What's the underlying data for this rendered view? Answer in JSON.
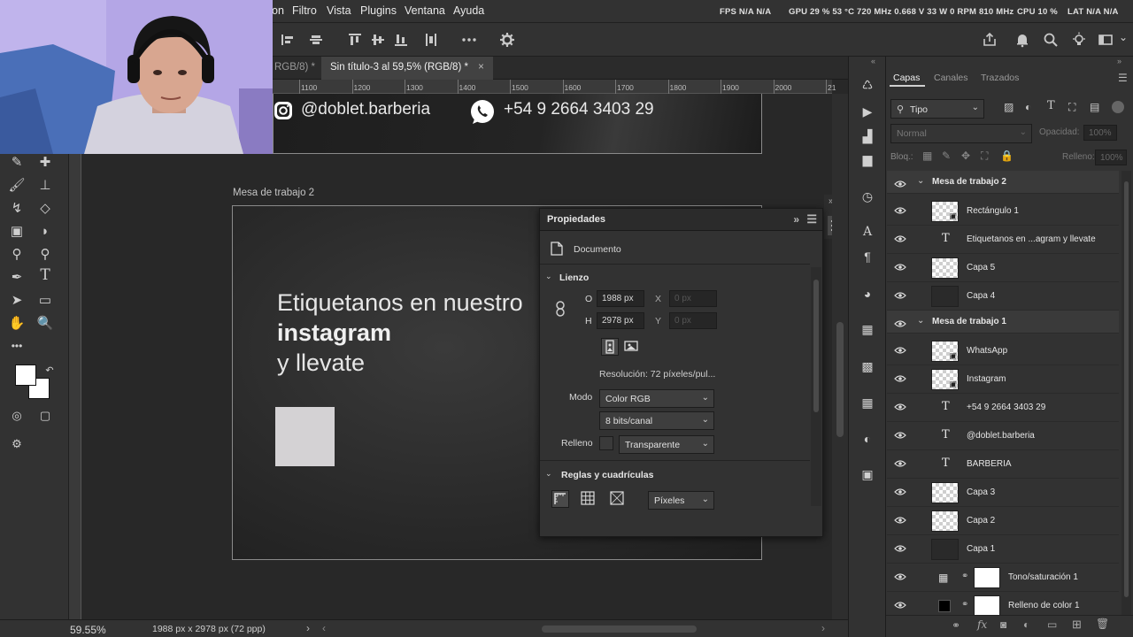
{
  "menubar": {
    "items": [
      "on",
      "Filtro",
      "Vista",
      "Plugins",
      "Ventana",
      "Ayuda"
    ],
    "perf": {
      "fps": "FPS  N/A  N/A",
      "gpu": "GPU 29 % 53 °C 720 MHz 0.668 V 33 W 0 RPM 810 MHz",
      "cpu": "CPU  10 %",
      "lat": "LAT  N/A  N/A"
    }
  },
  "tabs": {
    "inactive_label": "RGB/8) *",
    "active_label": "Sin título-3 al 59,5% (RGB/8) *",
    "close": "×"
  },
  "ruler": {
    "ticks": [
      "1100",
      "1200",
      "1300",
      "1400",
      "1500",
      "1600",
      "1700",
      "1800",
      "1900",
      "2000",
      "21"
    ]
  },
  "canvas": {
    "artboard_label": "Mesa de trabajo 2",
    "strip": {
      "instagram_handle": "@doblet.barberia",
      "phone": "+54 9 2664 3403 29"
    },
    "artboard": {
      "line1": "Etiquetanos en nuestro",
      "line2": "instagram",
      "line3": "y llevate"
    }
  },
  "properties": {
    "title": "Propiedades",
    "doc_label": "Documento",
    "section_canvas": "Lienzo",
    "w_label": "O",
    "w_value": "1988 px",
    "h_label": "H",
    "h_value": "2978 px",
    "x_label": "X",
    "x_value": "0 px",
    "y_label": "Y",
    "y_value": "0 px",
    "resolution": "Resolución:  72 píxeles/pul...",
    "mode_label": "Modo",
    "mode_value": "Color RGB",
    "depth_value": "8 bits/canal",
    "fill_label": "Relleno",
    "fill_value": "Transparente",
    "section_rulers": "Reglas y cuadrículas",
    "units_value": "Píxeles"
  },
  "layers": {
    "tabs": [
      "Capas",
      "Canales",
      "Trazados"
    ],
    "filter": "Tipo",
    "blend": "Normal",
    "opacity_label": "Opacidad:",
    "opacity_value": "100%",
    "lock_label": "Bloq.:",
    "fill_label": "Relleno:",
    "fill_value": "100%",
    "rows": [
      {
        "name": "Mesa de trabajo 2",
        "kind": "group"
      },
      {
        "name": "Rectángulo 1",
        "kind": "shape"
      },
      {
        "name": "Etiquetanos en ...agram y llevate",
        "kind": "text"
      },
      {
        "name": "Capa 5",
        "kind": "checker"
      },
      {
        "name": "Capa 4",
        "kind": "dark"
      },
      {
        "name": "Mesa de trabajo 1",
        "kind": "group"
      },
      {
        "name": "WhatsApp",
        "kind": "smart"
      },
      {
        "name": "Instagram",
        "kind": "smart"
      },
      {
        "name": "+54 9 2664 3403 29",
        "kind": "text"
      },
      {
        "name": "@doblet.barberia",
        "kind": "text"
      },
      {
        "name": "BARBERIA",
        "kind": "text"
      },
      {
        "name": "Capa 3",
        "kind": "checker"
      },
      {
        "name": "Capa 2",
        "kind": "checker"
      },
      {
        "name": "Capa 1",
        "kind": "dark"
      },
      {
        "name": "Tono/saturación 1",
        "kind": "adjust"
      },
      {
        "name": "Relleno de color 1",
        "kind": "fill"
      }
    ]
  },
  "status": {
    "zoom": "59.55%",
    "doc_size": "1988 px x 2978 px (72 ppp)"
  },
  "colors": {
    "accent": "#1473e6",
    "panel": "#323232",
    "canvas_bg": "#282828"
  }
}
